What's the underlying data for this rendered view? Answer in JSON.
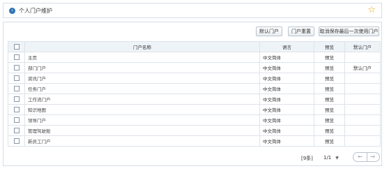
{
  "header": {
    "title": "个人门户维护"
  },
  "toolbar": {
    "default_label": "默认门户",
    "reset_label": "门户重置",
    "cancel_label": "取消保存最后一次使用门户"
  },
  "table": {
    "columns": {
      "name": "门户名称",
      "language": "语言",
      "preview": "预览",
      "default": "默认门户"
    },
    "rows": [
      {
        "name": "主页",
        "language": "中文简体",
        "preview": "预览",
        "default": ""
      },
      {
        "name": "部门门户",
        "language": "中文简体",
        "preview": "预览",
        "default": "默认门户"
      },
      {
        "name": "资讯门户",
        "language": "中文简体",
        "preview": "预览",
        "default": ""
      },
      {
        "name": "任务门户",
        "language": "中文简体",
        "preview": "预览",
        "default": ""
      },
      {
        "name": "工作流门户",
        "language": "中文简体",
        "preview": "预览",
        "default": ""
      },
      {
        "name": "知识地图",
        "language": "中文简体",
        "preview": "预览",
        "default": ""
      },
      {
        "name": "领导门户",
        "language": "中文简体",
        "preview": "预览",
        "default": ""
      },
      {
        "name": "管理驾驶舱",
        "language": "中文简体",
        "preview": "预览",
        "default": ""
      },
      {
        "name": "新员工门户",
        "language": "中文简体",
        "preview": "预览",
        "default": ""
      }
    ]
  },
  "pager": {
    "count": "[9条]",
    "page": "1/1"
  },
  "icons": {
    "title_bullet": "circle-arrow-right-icon",
    "favorite": "star-icon",
    "prev": "arrow-left-icon",
    "next": "arrow-right-icon"
  },
  "colors": {
    "accent": "#2e74b8",
    "star": "#e4a70c",
    "header_bg": "#eef3f8",
    "border": "#d6dde6"
  }
}
